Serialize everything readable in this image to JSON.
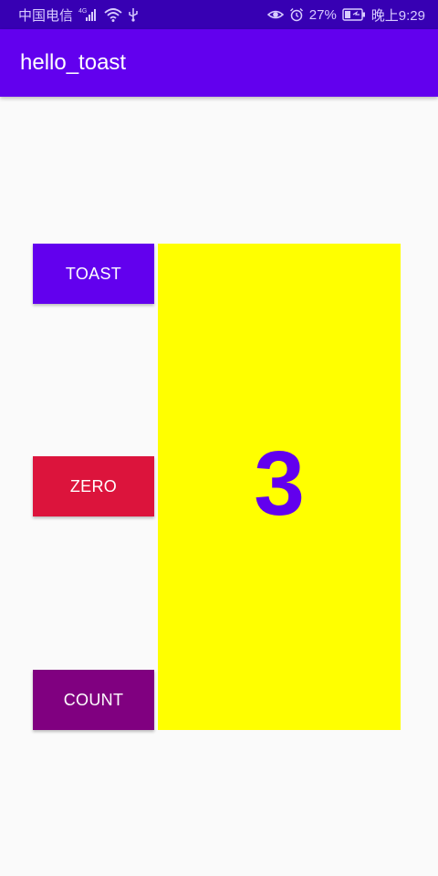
{
  "status_bar": {
    "carrier": "中国电信",
    "network_tag": "4G",
    "battery_percent": "27%",
    "time": "晚上9:29",
    "icons": [
      "signal-icon",
      "wifi-icon",
      "usb-icon",
      "eye-icon",
      "alarm-icon",
      "battery-icon"
    ]
  },
  "app_bar": {
    "title": "hello_toast"
  },
  "buttons": {
    "toast": "TOAST",
    "zero": "ZERO",
    "count": "COUNT"
  },
  "counter": {
    "value": "3"
  },
  "colors": {
    "status_bar": "#3700b3",
    "app_bar": "#6200ee",
    "toast_button": "#6200ee",
    "zero_button": "#dc143c",
    "count_button": "#800080",
    "count_panel": "#ffff00",
    "count_text": "#6200ee"
  }
}
